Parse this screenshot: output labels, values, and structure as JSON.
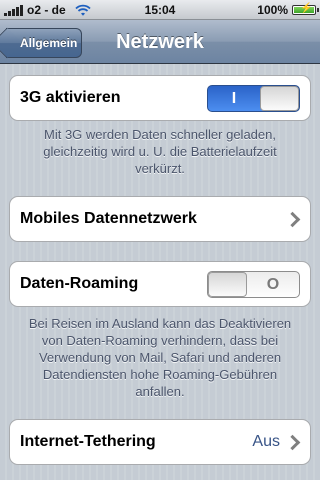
{
  "status_bar": {
    "carrier": "o2 - de",
    "time": "15:04",
    "battery": "100%",
    "battery_level": 1.0
  },
  "nav": {
    "back_label": "Allgemein",
    "title": "Netzwerk"
  },
  "settings": {
    "g3": {
      "label": "3G aktivieren",
      "switch_on": true,
      "switch_mark": "I",
      "footer": "Mit 3G werden Daten schneller geladen, gleichzeitig wird u. U. die Batterielaufzeit verkürzt."
    },
    "mobile_data": {
      "label": "Mobiles Datennetzwerk"
    },
    "roaming": {
      "label": "Daten-Roaming",
      "switch_on": false,
      "switch_mark": "O",
      "footer": "Bei Reisen im Ausland kann das Deaktivieren von Daten-Roaming verhindern, dass bei Verwendung von Mail, Safari und anderen Datendiensten hohe Roaming-Gebühren anfallen."
    },
    "tethering": {
      "label": "Internet-Tethering",
      "value": "Aus"
    }
  },
  "colors": {
    "background": "#c5ccd4",
    "switch_on": "#2b63c8",
    "detail_text": "#385487",
    "footer_text": "#4c566c"
  },
  "icons": [
    "signal-bars-icon",
    "wifi-icon",
    "battery-charging-icon",
    "chevron-right-icon",
    "back-arrow-icon"
  ]
}
